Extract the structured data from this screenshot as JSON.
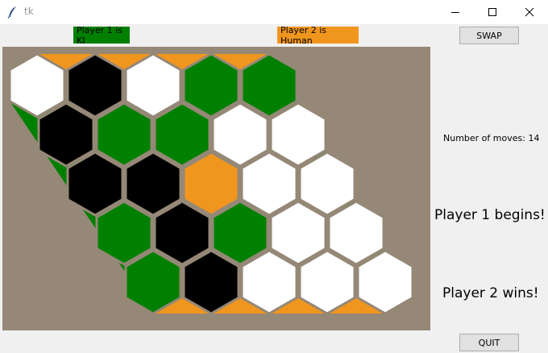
{
  "window": {
    "title": "tk",
    "icon": "feather-icon",
    "controls": [
      "minimize-icon",
      "maximize-icon",
      "close-icon"
    ]
  },
  "header": {
    "player1_label": "Player 1 is KI",
    "player1_color": "#008000",
    "player2_label": "Player 2 is Human",
    "player2_color": "#f0961e",
    "swap_button": "SWAP"
  },
  "board": {
    "size": 5,
    "background": "#958877",
    "edge_colors": {
      "player1_edges": "#008000",
      "player2_edges": "#f0961e"
    },
    "cell_colors": {
      "W": "#ffffff",
      "B": "#000000",
      "G": "#008000",
      "O": "#f0961e"
    },
    "cell_legend": {
      "W": "empty",
      "B": "black",
      "G": "player 1",
      "O": "player 2"
    },
    "rows": [
      [
        "W",
        "B",
        "W",
        "G",
        "G"
      ],
      [
        "B",
        "G",
        "G",
        "W",
        "W"
      ],
      [
        "B",
        "B",
        "O",
        "W",
        "W"
      ],
      [
        "G",
        "B",
        "G",
        "W",
        "W"
      ],
      [
        "G",
        "B",
        "W",
        "W",
        "W"
      ]
    ]
  },
  "status": {
    "moves_text": "Number of moves: 14",
    "begins_text": "Player 1 begins!",
    "winner_text": "Player 2 wins!"
  },
  "footer": {
    "quit_button": "QUIT"
  }
}
